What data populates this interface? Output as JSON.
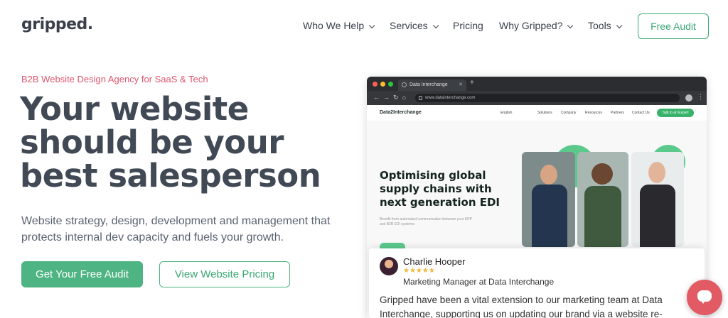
{
  "nav": {
    "logo": "gripped.",
    "items": [
      {
        "label": "Who We Help",
        "dropdown": true
      },
      {
        "label": "Services",
        "dropdown": true
      },
      {
        "label": "Pricing",
        "dropdown": false
      },
      {
        "label": "Why Gripped?",
        "dropdown": true
      },
      {
        "label": "Tools",
        "dropdown": true
      }
    ],
    "cta": "Free Audit"
  },
  "hero": {
    "eyebrow": "B2B Website Design Agency for SaaS & Tech",
    "headline_lines": [
      "Your website",
      "should be your",
      "best salesperson"
    ],
    "subtext": "Website strategy, design, development and management that protects internal dev capacity and fuels your growth.",
    "primary_cta": "Get Your Free Audit",
    "secondary_cta": "View Website Pricing"
  },
  "mockup": {
    "tab_title": "Data Interchange",
    "new_tab": "+",
    "url": "www.datainterchange.com",
    "site": {
      "logo": "Data2Interchange",
      "lang": "English",
      "nav": [
        "Solutions",
        "Company",
        "Resources",
        "Partners",
        "Contact Us"
      ],
      "cta": "Talk to an Expert",
      "hero_title": "Optimising global supply chains with next generation EDI",
      "hero_sub": "Benefit from automated communication between your ERP and B2B EDI systems"
    }
  },
  "testimonial": {
    "name": "Charlie Hooper",
    "stars": "★★★★★",
    "role": "Marketing Manager at Data Interchange",
    "quote": "Gripped have been a vital extension to our marketing team at Data Interchange, supporting us on updating our brand via a website re-"
  },
  "colors": {
    "accent_green": "#4fb483",
    "eyebrow_pink": "#e0576f",
    "heading": "#414955",
    "chat_red": "#e25a63"
  },
  "icons": {
    "chevron": "chevron-down-icon",
    "chat": "chat-icon"
  }
}
